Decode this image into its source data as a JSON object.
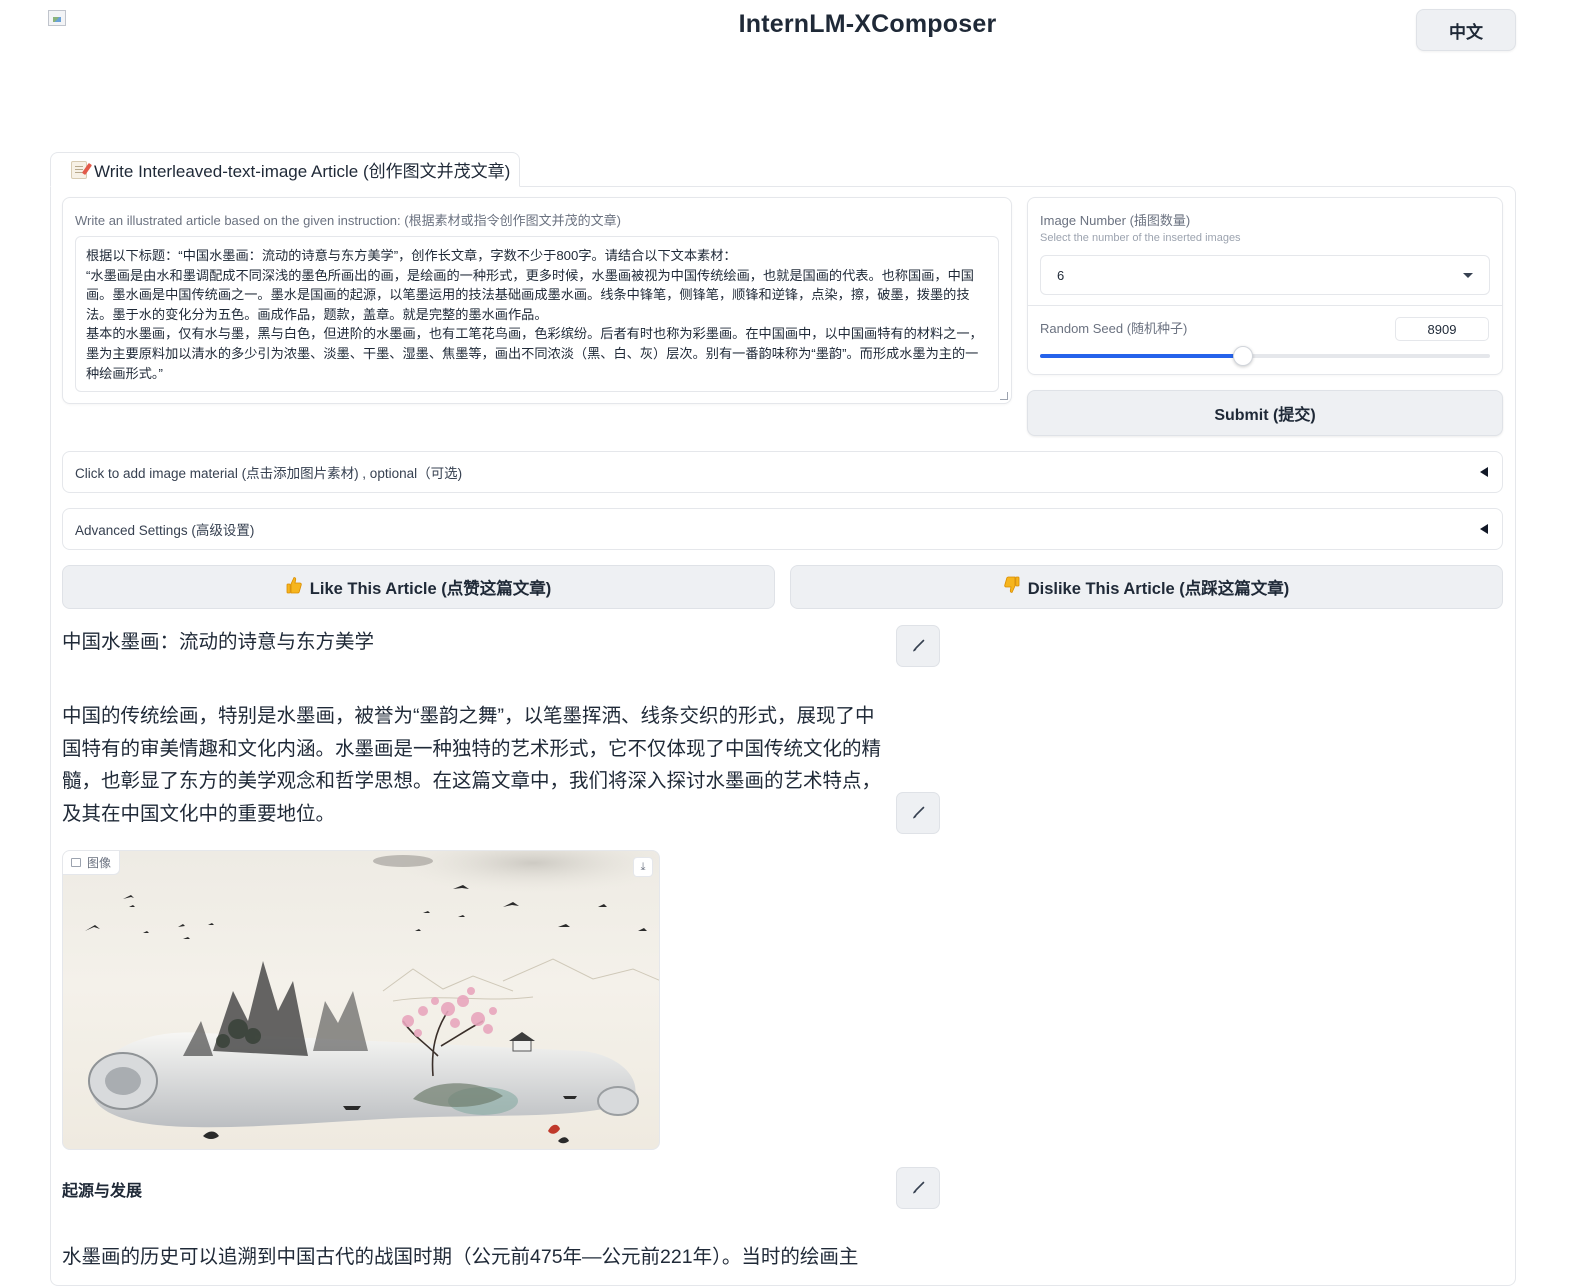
{
  "header": {
    "title": "InternLM-XComposer",
    "lang_button": "中文"
  },
  "tabs": [
    {
      "label": "Write Interleaved-text-image Article (创作图文并茂文章)",
      "icon": "memo-icon"
    }
  ],
  "instruction": {
    "label": "Write an illustrated article based on the given instruction: (根据素材或指令创作图文并茂的文章)",
    "value": "根据以下标题：“中国水墨画：流动的诗意与东方美学”，创作长文章，字数不少于800字。请结合以下文本素材：\n“水墨画是由水和墨调配成不同深浅的墨色所画出的画，是绘画的一种形式，更多时候，水墨画被视为中国传统绘画，也就是国画的代表。也称国画，中国画。墨水画是中国传统画之一。墨水是国画的起源，以笔墨运用的技法基础画成墨水画。线条中锋笔，侧锋笔，顺锋和逆锋，点染，擦，破墨，拨墨的技法。墨于水的变化分为五色。画成作品，题款，盖章。就是完整的墨水画作品。\n基本的水墨画，仅有水与墨，黑与白色，但进阶的水墨画，也有工笔花鸟画，色彩缤纷。后者有时也称为彩墨画。在中国画中，以中国画特有的材料之一，墨为主要原料加以清水的多少引为浓墨、淡墨、干墨、湿墨、焦墨等，画出不同浓淡（黑、白、灰）层次。别有一番韵味称为“墨韵”。而形成水墨为主的一种绘画形式。”"
  },
  "settings": {
    "image_number_label": "Image Number (插图数量)",
    "image_number_sub": "Select the number of the inserted images",
    "image_number_value": "6",
    "seed_label": "Random Seed (随机种子)",
    "seed_value": "8909",
    "seed_fraction": 0.45
  },
  "submit_label": "Submit (提交)",
  "accordions": {
    "image_material": "Click to add image material (点击添加图片素材) , optional（可选)",
    "advanced": "Advanced Settings (高级设置)"
  },
  "feedback": {
    "like": "Like This Article (点赞这篇文章)",
    "dislike": "Dislike This Article (点踩这篇文章)"
  },
  "article": {
    "title": "中国水墨画：流动的诗意与东方美学",
    "intro": "中国的传统绘画，特别是水墨画，被誉为“墨韵之舞”，以笔墨挥洒、线条交织的形式，展现了中国特有的审美情趣和文化内涵。水墨画是一种独特的艺术形式，它不仅体现了中国传统文化的精髓，也彰显了东方的美学观念和哲学思想。在这篇文章中，我们将深入探讨水墨画的艺术特点，及其在中国文化中的重要地位。",
    "image_label": "图像",
    "section_title": "起源与发展",
    "section_para": "水墨画的历史可以追溯到中国古代的战国时期（公元前475年—公元前221年）。当时的绘画主"
  },
  "colors": {
    "accent": "#2563eb",
    "button_bg": "#eef0f3",
    "border": "#e5e7eb"
  }
}
